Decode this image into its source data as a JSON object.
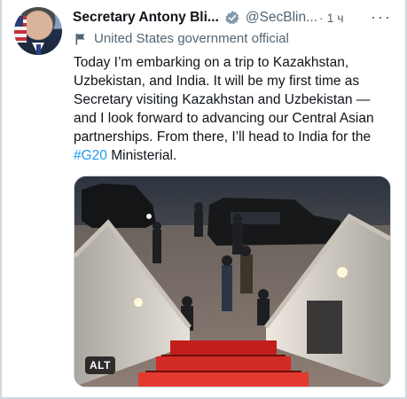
{
  "tweet": {
    "display_name": "Secretary Antony Bli...",
    "handle": "@SecBlin...",
    "time": "· 1 ч",
    "more": "···",
    "affiliation": "United States government official",
    "text_part1": "Today I’m embarking on a trip to Kazakhstan, Uzbekistan, and India. It will be my first time as Secretary visiting Kazakhstan and Uzbekistan — and I look forward to advancing our Central Asian partnerships. From there, I’ll head to India for the ",
    "hashtag": "#G20",
    "text_part2": " Ministerial.",
    "media": {
      "alt_label": "ALT"
    }
  },
  "icons": {
    "verified": "verified-badge-icon",
    "affiliation": "government-flag-icon",
    "more": "more-options-icon"
  },
  "colors": {
    "accent": "#1d9bf0",
    "secondary_text": "#536471",
    "primary_text": "#0f1419"
  }
}
